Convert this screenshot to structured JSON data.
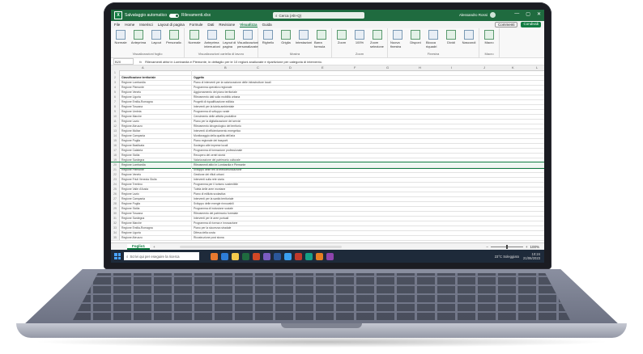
{
  "window": {
    "app_name": "Rilevamenti.xlsx",
    "toggle_label": "Salvataggio automatico",
    "search_placeholder": "Cerca (Alt+Q)",
    "user_name": "Alessandro Rossi",
    "window_controls": [
      "—",
      "▢",
      "✕"
    ]
  },
  "menu": {
    "tabs": [
      "File",
      "Home",
      "Inserisci",
      "Layout di pagina",
      "Formule",
      "Dati",
      "Revisione",
      "Visualizza",
      "Guida"
    ],
    "active_tab": "Visualizza",
    "comments_label": "Commenti",
    "share_label": "Condividi"
  },
  "ribbon": {
    "groups": [
      {
        "name": "Visualizzazioni foglio",
        "items": [
          "Normale",
          "Anteprima",
          "Layout",
          "Personaliz."
        ]
      },
      {
        "name": "Visualizzazioni cartella di lavoro",
        "items": [
          "Normale",
          "Anteprima interruzioni",
          "Layout di pagina",
          "Visualizzazioni personalizzate"
        ]
      },
      {
        "name": "Mostra",
        "items": [
          "Righello",
          "Griglia",
          "Intestazioni",
          "Barra formula"
        ]
      },
      {
        "name": "Zoom",
        "items": [
          "Zoom",
          "100%",
          "Zoom selezione"
        ]
      },
      {
        "name": "Finestra",
        "items": [
          "Nuova finestra",
          "Disponi",
          "Blocca riquadri",
          "Dividi",
          "Nascondi"
        ]
      },
      {
        "name": "Macro",
        "items": [
          "Macro"
        ]
      }
    ]
  },
  "formula_bar": {
    "cell_ref": "B20",
    "fx": "fx",
    "content": "Rilevamenti attivi in Lombardia e Piemonte, in dettaglio per le 10 regioni analizzate e ripartizione per categoria di intervento."
  },
  "columns": [
    "A",
    "B",
    "C",
    "D",
    "E",
    "F",
    "G",
    "H",
    "I",
    "J",
    "K",
    "L"
  ],
  "rows": [
    {
      "n": "1",
      "a": "",
      "b": ""
    },
    {
      "n": "2",
      "a": "Classificazione territoriale",
      "b": "Oggetto",
      "header": true
    },
    {
      "n": "3",
      "a": "Regione Lombardia",
      "b": "Piano di interventi per la valorizzazione delle infrastrutture locali"
    },
    {
      "n": "4",
      "a": "Regione Piemonte",
      "b": "Programma operativo regionale"
    },
    {
      "n": "5",
      "a": "Regione Veneto",
      "b": "Aggiornamento del piano territoriale"
    },
    {
      "n": "6",
      "a": "Regione Liguria",
      "b": "Rilevamento dati sulla mobilità urbana"
    },
    {
      "n": "7",
      "a": "Regione Emilia-Romagna",
      "b": "Progetti di riqualificazione edilizia"
    },
    {
      "n": "8",
      "a": "Regione Toscana",
      "b": "Interventi per la tutela ambientale"
    },
    {
      "n": "9",
      "a": "Regione Umbria",
      "b": "Programma di sviluppo rurale"
    },
    {
      "n": "10",
      "a": "Regione Marche",
      "b": "Censimento delle attività produttive"
    },
    {
      "n": "11",
      "a": "Regione Lazio",
      "b": "Piano per la digitalizzazione dei servizi"
    },
    {
      "n": "12",
      "a": "Regione Abruzzo",
      "b": "Rilevamento idrogeologico del territorio"
    },
    {
      "n": "13",
      "a": "Regione Molise",
      "b": "Interventi di efficientamento energetico"
    },
    {
      "n": "14",
      "a": "Regione Campania",
      "b": "Monitoraggio della qualità dell'aria"
    },
    {
      "n": "15",
      "a": "Regione Puglia",
      "b": "Piano regionale dei trasporti"
    },
    {
      "n": "16",
      "a": "Regione Basilicata",
      "b": "Sostegno alle imprese locali"
    },
    {
      "n": "17",
      "a": "Regione Calabria",
      "b": "Programma di formazione professionale"
    },
    {
      "n": "18",
      "a": "Regione Sicilia",
      "b": "Recupero dei centri storici"
    },
    {
      "n": "19",
      "a": "Regione Sardegna",
      "b": "Valorizzazione del patrimonio culturale"
    },
    {
      "n": "20",
      "a": "Regione Lombardia",
      "b": "Rilevamenti attivi in Lombardia e Piemonte",
      "selected": true
    },
    {
      "n": "21",
      "a": "Regione Piemonte",
      "b": "Sviluppo delle reti di telecomunicazione"
    },
    {
      "n": "22",
      "a": "Regione Veneto",
      "b": "Gestione dei rifiuti urbani"
    },
    {
      "n": "23",
      "a": "Regione Friuli Venezia Giulia",
      "b": "Interventi sulla rete viaria"
    },
    {
      "n": "24",
      "a": "Regione Trentino",
      "b": "Programma per il turismo sostenibile"
    },
    {
      "n": "25",
      "a": "Regione Valle d'Aosta",
      "b": "Tutela delle aree montane"
    },
    {
      "n": "26",
      "a": "Regione Lazio",
      "b": "Piano di edilizia scolastica"
    },
    {
      "n": "27",
      "a": "Regione Campania",
      "b": "Interventi per la sanità territoriale"
    },
    {
      "n": "28",
      "a": "Regione Puglia",
      "b": "Sviluppo delle energie rinnovabili"
    },
    {
      "n": "29",
      "a": "Regione Sicilia",
      "b": "Programma di inclusione sociale"
    },
    {
      "n": "30",
      "a": "Regione Toscana",
      "b": "Rilevamento del patrimonio forestale"
    },
    {
      "n": "31",
      "a": "Regione Sardegna",
      "b": "Interventi per le aree portuali"
    },
    {
      "n": "32",
      "a": "Regione Marche",
      "b": "Programma di ricerca e innovazione"
    },
    {
      "n": "33",
      "a": "Regione Emilia-Romagna",
      "b": "Piano per la sicurezza stradale"
    },
    {
      "n": "34",
      "a": "Regione Liguria",
      "b": "Difesa della costa"
    },
    {
      "n": "35",
      "a": "Regione Abruzzo",
      "b": "Ricostruzione post sisma"
    }
  ],
  "sheetbar": {
    "sheet_name": "Foglio1",
    "add_label": "+",
    "zoom_level": "100%"
  },
  "taskbar": {
    "search_placeholder": "Scrivi qui per eseguire la ricerca",
    "weather": "23°C Soleggiato",
    "time": "10:24",
    "date": "21/06/2023",
    "app_colors": [
      "#e8792f",
      "#2e7dd7",
      "#f2c94c",
      "#1f6b3f",
      "#d24726",
      "#7a5cc0",
      "#2b579a",
      "#3aa0f0",
      "#c0392b",
      "#16a085",
      "#e67e22",
      "#8e44ad"
    ]
  }
}
